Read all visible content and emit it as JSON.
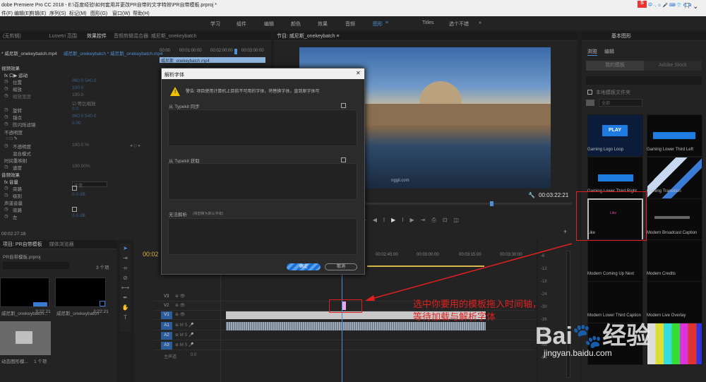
{
  "window": {
    "title": "dobe Premiere Pro CC 2018 - E:\\百度经验\\如何套用并更改PR自带的文字特效\\PR自带模板.prproj *",
    "controls": [
      "—",
      "☐",
      "✕"
    ],
    "tray_badge": "S",
    "tray_text": "中 ·, ☺ 🎤 ⌨ 👕 ⚙ ⊞"
  },
  "menu": {
    "items": [
      "剪辑(E)",
      "序列(S)",
      "标记(M)",
      "图形(G)",
      "窗口(W)",
      "帮助(H)"
    ],
    "first": "编辑(E)",
    "partial": "件(F)"
  },
  "workspaces": {
    "items": [
      "学习",
      "组件",
      "编辑",
      "颜色",
      "效果",
      "音频",
      "图形",
      "Titles",
      "选个不错"
    ],
    "active": "图形",
    "more": "»"
  },
  "effect_controls": {
    "tabs": [
      "(无剪辑)",
      "Lumetri 范围",
      "效果控件",
      "音频剪辑混合器: 威尼斯_onekeybatch",
      "≡"
    ],
    "active_tab": "效果控件",
    "header_clip": "* 威尼斯_onekeybatch.mp4",
    "header_seq": "威尼斯_onekeybatch * 威尼斯_onekeybatch.mp4",
    "ruler": [
      "00:00",
      "00:01:00:00",
      "00:02:00:00",
      "00:03:00:00"
    ],
    "clip_label": "威尼斯_onekeybatch.mp4",
    "rows": [
      {
        "label": "视频效果",
        "value": ""
      },
      {
        "label": "fx 口▶ 运动",
        "value": ""
      },
      {
        "label": "位置",
        "value": "960.0    540.0"
      },
      {
        "label": "缩放",
        "value": "100.0"
      },
      {
        "label": "缩放宽度",
        "value": "100.0"
      },
      {
        "label": "",
        "value": "☑ 等比缩放"
      },
      {
        "label": "旋转",
        "value": "0.0"
      },
      {
        "label": "锚点",
        "value": "960.0    540.0"
      },
      {
        "label": "防闪烁滤镜",
        "value": "0.00"
      },
      {
        "label": "不透明度",
        "value": ""
      },
      {
        "label": "○ □ ✎",
        "value": ""
      },
      {
        "label": "不透明度",
        "value": "100.0 %"
      },
      {
        "label": "混合模式",
        "value": "正常"
      },
      {
        "label": "时间重映射",
        "value": ""
      },
      {
        "label": "速度",
        "value": "100.00%"
      },
      {
        "label": "音频效果",
        "value": ""
      },
      {
        "label": "fx 音量",
        "value": ""
      },
      {
        "label": "旁路",
        "value": ""
      },
      {
        "label": "级别",
        "value": "0.0 dB"
      },
      {
        "label": "声道音量",
        "value": ""
      },
      {
        "label": "旁路",
        "value": ""
      },
      {
        "label": "左",
        "value": "0.0 dB"
      }
    ],
    "timecode": "00:02:27:18"
  },
  "program": {
    "tab": "节目: 威尼斯_onekeybatch ≡",
    "watermark": "nggil.com",
    "timecode": "00:03:22:21",
    "controls": [
      "◂",
      "▸",
      "{",
      "}",
      "⇤",
      "◀I",
      "▶",
      "I▶",
      "⇥",
      "⎙",
      "⊡",
      "◫",
      "⤓"
    ]
  },
  "project": {
    "tabs": [
      "项目: PR自带模板",
      "媒体浏览器"
    ],
    "name": "PR自带模板.prproj",
    "count": "3 个项",
    "items": [
      {
        "name": "威尼斯_onekeybatch...",
        "duration": "3:22:21"
      },
      {
        "name": "威尼斯_onekeybatch",
        "duration": "3:22:21"
      },
      {
        "name": "动态图形模...",
        "duration": "1 个项"
      }
    ]
  },
  "timeline": {
    "timecode": "00:02",
    "ruler": [
      "00:02:45:00",
      "00:03:00:00",
      "00:03:15:00",
      "00:03:30:00"
    ],
    "tracks": [
      {
        "name": "V3"
      },
      {
        "name": "V2"
      },
      {
        "name": "V1"
      },
      {
        "name": "A1"
      },
      {
        "name": "A2"
      },
      {
        "name": "A3"
      }
    ],
    "master": "主声道",
    "master_value": "0.0",
    "meter": [
      "-6",
      "-12",
      "-18",
      "-24",
      "-30",
      "-36",
      "-42",
      "-48",
      "-54"
    ]
  },
  "essential_graphics": {
    "tabs": [
      "基本图形"
    ],
    "subtabs": [
      "浏览",
      "编辑"
    ],
    "buttons": [
      "我的模板",
      "Adobe Stock"
    ],
    "checkbox": "本地模板文件夹",
    "folder": "全部",
    "templates": [
      {
        "name": "Gaming Logo Loop"
      },
      {
        "name": "Gaming Lower Third Left"
      },
      {
        "name": "Gaming Lower Third Right"
      },
      {
        "name": "Gaming Transition"
      },
      {
        "name": "Like"
      },
      {
        "name": "Modern Broadcast Caption"
      },
      {
        "name": "Modern Coming Up Next"
      },
      {
        "name": "Modern Credits"
      },
      {
        "name": "Modern Lower Third Caption"
      },
      {
        "name": "Modern Live Overlay"
      },
      {
        "name": ""
      },
      {
        "name": ""
      }
    ],
    "like_text": "Like"
  },
  "dialog": {
    "title": "解析字体",
    "close": "✕",
    "warning": "警告: 项目使用计算机上目前不可用的字体，将替换字体，直到原字体可",
    "section1": "从 Typekit 同步",
    "section2": "从 Typekit 获取",
    "section3": "无法解析",
    "section3_note": "(将替换为默认字体)",
    "ok": "确定",
    "cancel": "取消"
  },
  "annotation": {
    "line1": "选中你要用的模板拖入时间轴，",
    "line2": "等待加载与解析字体",
    "color": "#e02020"
  },
  "watermark": {
    "brand": "Bai",
    "brand2": "经验",
    "site": "jingyan.baidu.com"
  }
}
